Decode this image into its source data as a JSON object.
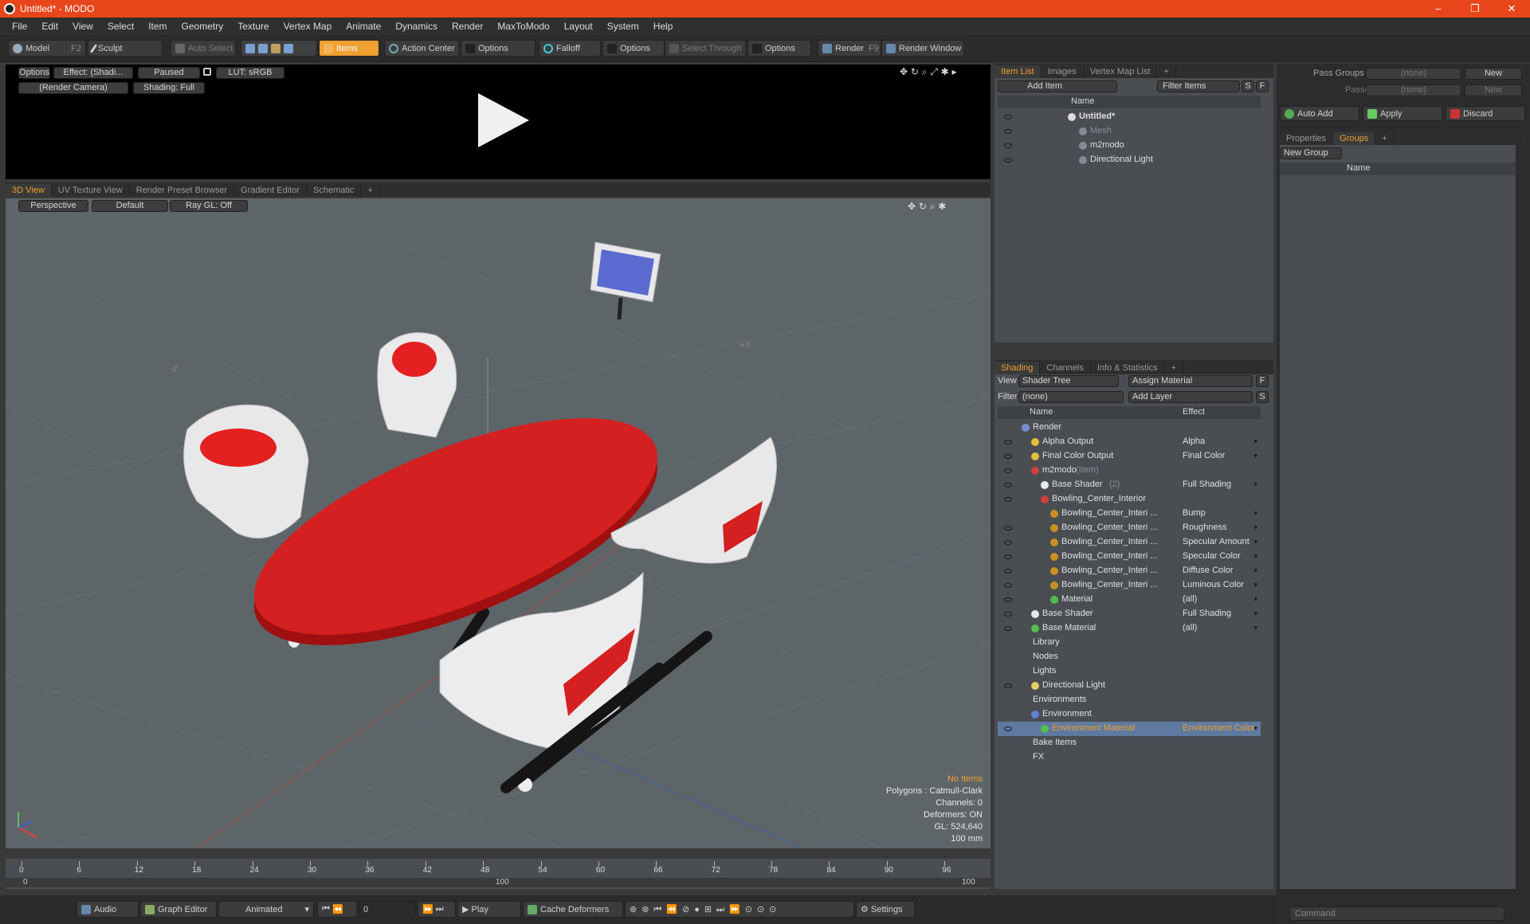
{
  "window": {
    "title": "Untitled* - MODO",
    "min": "–",
    "max": "❐",
    "close": "✕"
  },
  "menu": [
    "File",
    "Edit",
    "View",
    "Select",
    "Item",
    "Geometry",
    "Texture",
    "Vertex Map",
    "Animate",
    "Dynamics",
    "Render",
    "MaxToModo",
    "Layout",
    "System",
    "Help"
  ],
  "toolbar": {
    "model": "Model",
    "model_key": "F2",
    "sculpt": "Sculpt",
    "auto_select": "Auto Select",
    "items": "Items",
    "action_center": "Action Center",
    "options1": "Options",
    "falloff": "Falloff",
    "options2": "Options",
    "select_through": "Select Through",
    "options3": "Options",
    "render": "Render",
    "render_key": "F9",
    "render_window": "Render Window"
  },
  "render_preview": {
    "options": "Options",
    "effect": "Effect: (Shadi...",
    "paused": "Paused",
    "lut": "LUT: sRGB",
    "camera": "(Render Camera)",
    "shading": "Shading: Full"
  },
  "viewport_tabs": [
    "3D View",
    "UV Texture View",
    "Render Preset Browser",
    "Gradient Editor",
    "Schematic",
    "+"
  ],
  "viewport": {
    "perspective": "Perspective",
    "default": "Default",
    "raygl": "Ray GL: Off",
    "x_label": "+X",
    "z_label": "-Z",
    "stats": [
      "No Items",
      "Polygons : Catmull-Clark",
      "Channels: 0",
      "Deformers: ON",
      "GL: 524,640",
      "100 mm"
    ]
  },
  "timeline": {
    "ticks": [
      "0",
      "6",
      "12",
      "18",
      "24",
      "30",
      "36",
      "42",
      "48",
      "54",
      "60",
      "66",
      "72",
      "78",
      "84",
      "90",
      "96"
    ],
    "range_start": "0",
    "range_mid": "100",
    "range_end": "100"
  },
  "bottombar": {
    "audio": "Audio",
    "graph_editor": "Graph Editor",
    "animated": "Animated",
    "frame": "0",
    "play": "Play",
    "cache": "Cache Deformers",
    "settings": "Settings"
  },
  "item_list": {
    "tabs": [
      "Item List",
      "Images",
      "Vertex Map List",
      "+"
    ],
    "add_item": "Add Item",
    "filter": "Filter Items",
    "s_btn": "S",
    "f_btn": "F",
    "header_name": "Name",
    "rows": [
      {
        "label": "Untitled*",
        "indent": 0,
        "bold": true
      },
      {
        "label": "Mesh",
        "indent": 1,
        "dim": true
      },
      {
        "label": "m2modo",
        "indent": 1
      },
      {
        "label": "Directional Light",
        "indent": 1
      }
    ]
  },
  "shading": {
    "tabs": [
      "Shading",
      "Channels",
      "Info & Statistics",
      "+"
    ],
    "view_label": "View",
    "view_value": "Shader Tree",
    "assign": "Assign Material",
    "f_btn": "F",
    "filter_label": "Filter",
    "filter_value": "(none)",
    "add_layer": "Add Layer",
    "s_btn": "S",
    "col_name": "Name",
    "col_effect": "Effect",
    "rows": [
      {
        "label": "Render",
        "effect": "",
        "indent": 0,
        "color": "#7a8ad0",
        "eye": false
      },
      {
        "label": "Alpha Output",
        "effect": "Alpha",
        "indent": 1,
        "color": "#e0c040",
        "eye": true
      },
      {
        "label": "Final Color Output",
        "effect": "Final Color",
        "indent": 1,
        "color": "#e0c040",
        "eye": true
      },
      {
        "label": "m2modo",
        "suffix": "(Item)",
        "effect": "",
        "indent": 1,
        "color": "#d04040",
        "eye": true
      },
      {
        "label": "Base Shader",
        "suffix": "(2)",
        "effect": "Full Shading",
        "indent": 2,
        "color": "#e8e8e8",
        "eye": true
      },
      {
        "label": "Bowling_Center_Interior",
        "effect": "",
        "indent": 2,
        "color": "#d04040",
        "eye": true
      },
      {
        "label": "Bowling_Center_Interi ...",
        "effect": "Bump",
        "indent": 3,
        "color": "#c89020",
        "eye": false
      },
      {
        "label": "Bowling_Center_Interi ...",
        "effect": "Roughness",
        "indent": 3,
        "color": "#c89020",
        "eye": true
      },
      {
        "label": "Bowling_Center_Interi ...",
        "effect": "Specular Amount",
        "indent": 3,
        "color": "#c89020",
        "eye": true
      },
      {
        "label": "Bowling_Center_Interi ...",
        "effect": "Specular Color",
        "indent": 3,
        "color": "#c89020",
        "eye": true
      },
      {
        "label": "Bowling_Center_Interi ...",
        "effect": "Diffuse Color",
        "indent": 3,
        "color": "#c89020",
        "eye": true
      },
      {
        "label": "Bowling_Center_Interi ...",
        "effect": "Luminous Color",
        "indent": 3,
        "color": "#c89020",
        "eye": true
      },
      {
        "label": "Material",
        "effect": "(all)",
        "indent": 3,
        "color": "#50c050",
        "eye": true
      },
      {
        "label": "Base Shader",
        "effect": "Full Shading",
        "indent": 1,
        "color": "#e8e8e8",
        "eye": true
      },
      {
        "label": "Base Material",
        "effect": "(all)",
        "indent": 1,
        "color": "#50c050",
        "eye": true
      },
      {
        "label": "Library",
        "effect": "",
        "indent": 0,
        "color": "",
        "eye": false
      },
      {
        "label": "Nodes",
        "effect": "",
        "indent": 0,
        "color": "",
        "eye": false
      },
      {
        "label": "Lights",
        "effect": "",
        "indent": 0,
        "color": "",
        "eye": false
      },
      {
        "label": "Directional Light",
        "effect": "",
        "indent": 1,
        "color": "#e0d060",
        "eye": true
      },
      {
        "label": "Environments",
        "effect": "",
        "indent": 0,
        "color": "",
        "eye": false
      },
      {
        "label": "Environment",
        "effect": "",
        "indent": 1,
        "color": "#6080d0",
        "eye": false
      },
      {
        "label": "Environment Material",
        "effect": "Environment Color",
        "indent": 2,
        "color": "#50c050",
        "eye": true,
        "selected": true
      },
      {
        "label": "Bake Items",
        "effect": "",
        "indent": 0,
        "color": "",
        "eye": false
      },
      {
        "label": "FX",
        "effect": "",
        "indent": 0,
        "color": "",
        "eye": false
      }
    ]
  },
  "groups": {
    "pass_groups": "Pass Groups",
    "pass_value": "(none)",
    "new1": "New",
    "passes": "Passes",
    "passes_value": "(none)",
    "new2": "New",
    "auto_add": "Auto Add",
    "apply": "Apply",
    "discard": "Discard",
    "tabs": [
      "Properties",
      "Groups",
      "+"
    ],
    "new_group": "New Group",
    "header_name": "Name",
    "command": "Command"
  }
}
